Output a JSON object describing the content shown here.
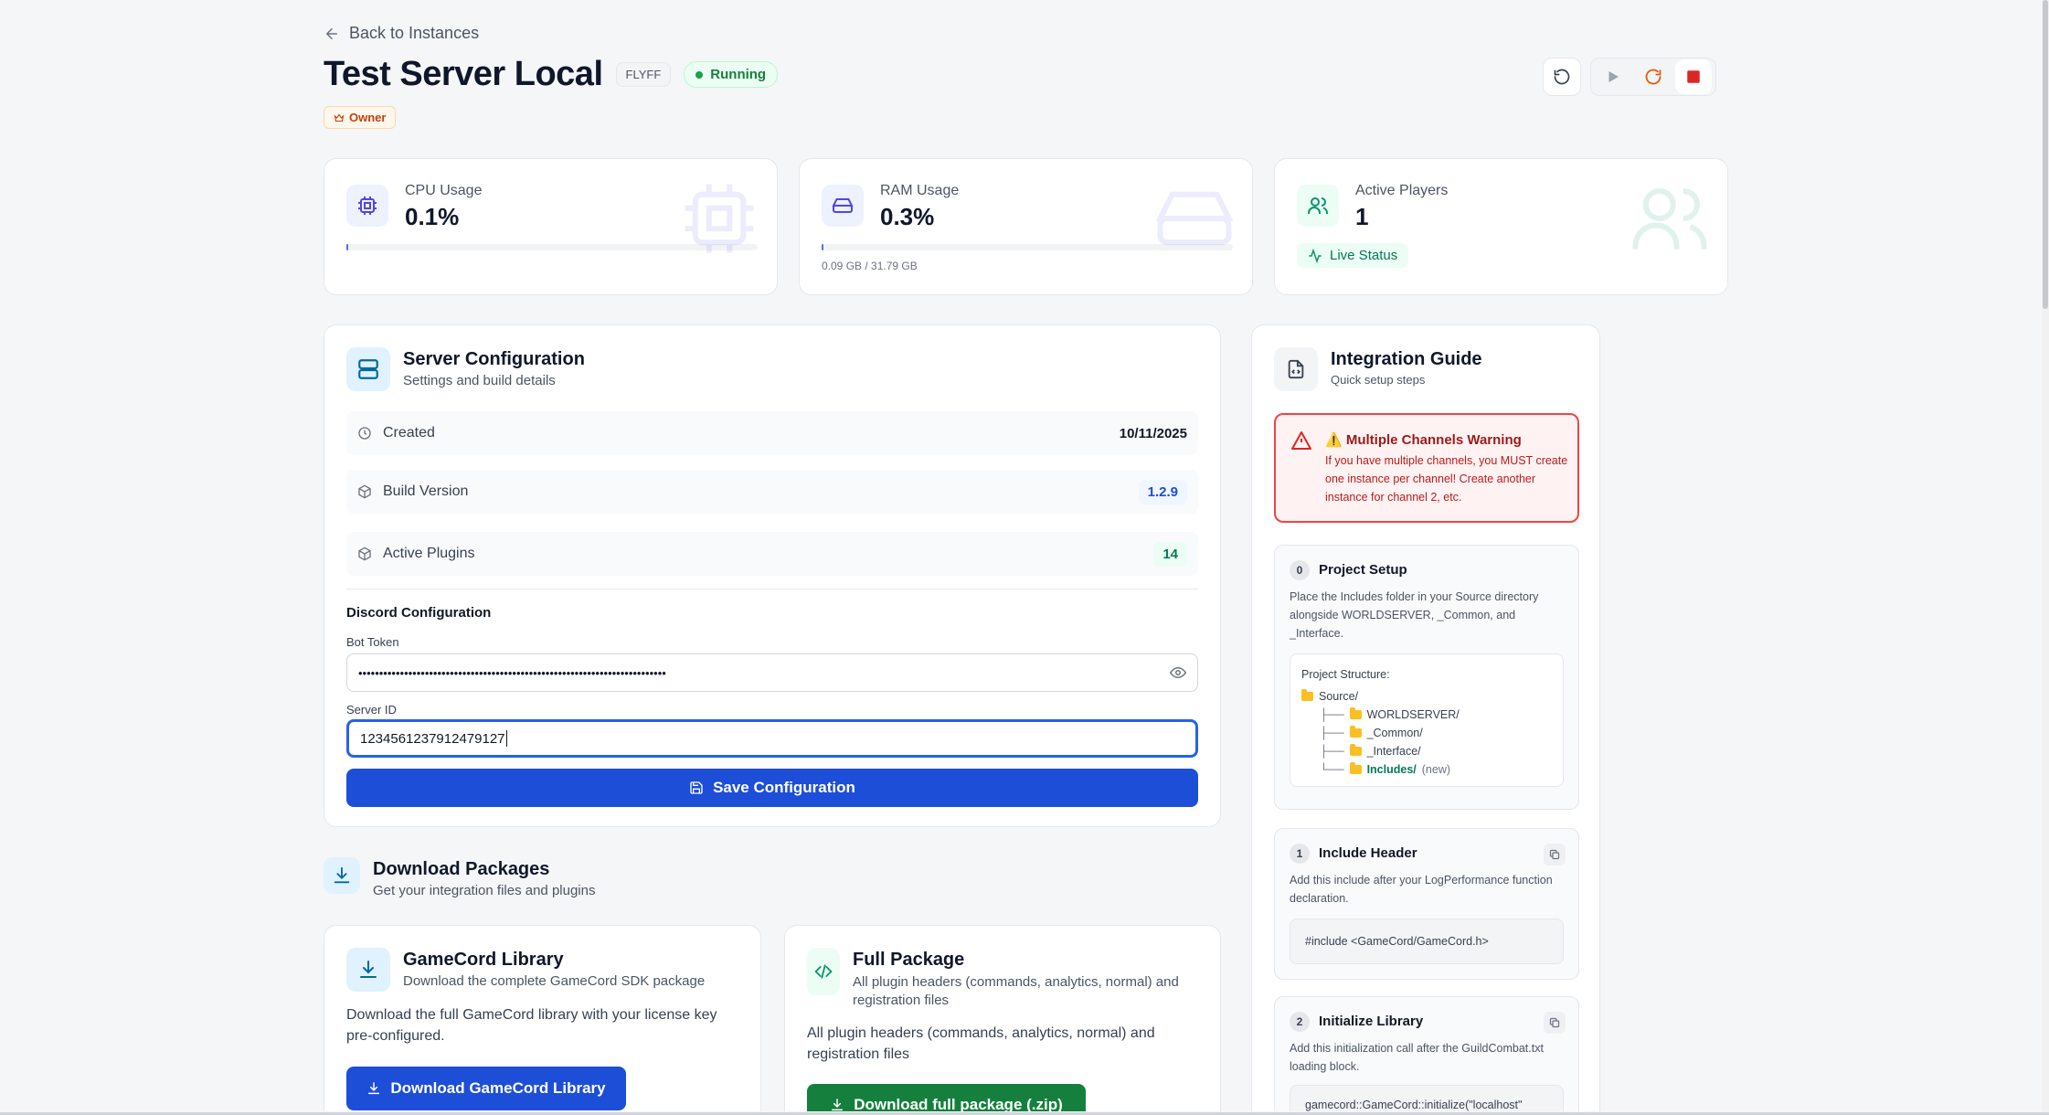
{
  "nav": {
    "back_label": "Back to Instances"
  },
  "instance": {
    "title": "Test Server Local",
    "game_tag": "FLYFF",
    "status": "Running",
    "role": "Owner"
  },
  "stats": {
    "cpu": {
      "label": "CPU Usage",
      "value": "0.1%",
      "fraction": 0.001
    },
    "ram": {
      "label": "RAM Usage",
      "value": "0.3%",
      "fraction": 0.003,
      "detail": "0.09 GB / 31.79 GB"
    },
    "players": {
      "label": "Active Players",
      "value": "1",
      "live_label": "Live Status"
    }
  },
  "server_config": {
    "title": "Server Configuration",
    "subtitle": "Settings and build details",
    "rows": [
      {
        "label": "Created",
        "value": "10/11/2025"
      },
      {
        "label": "Build Version",
        "value": "1.2.9"
      },
      {
        "label": "Active Plugins",
        "value": "14"
      }
    ],
    "discord": {
      "heading": "Discord Configuration",
      "bot_token_label": "Bot Token",
      "bot_token_value": "••••••••••••••••••••••••••••••••••••••••••••••••••••••••••••••••••••••••••",
      "server_id_label": "Server ID",
      "server_id_value": "1234561237912479127"
    },
    "save_label": "Save Configuration"
  },
  "downloads": {
    "title": "Download Packages",
    "subtitle": "Get your integration files and plugins",
    "library": {
      "title": "GameCord Library",
      "subtitle": "Download the complete GameCord SDK package",
      "body": "Download the full GameCord library with your license key pre-configured.",
      "button": "Download GameCord Library"
    },
    "full": {
      "title": "Full Package",
      "subtitle": "All plugin headers (commands, analytics, normal) and registration files",
      "body": "All plugin headers (commands, analytics, normal) and registration files",
      "button": "Download full package (.zip)"
    }
  },
  "guide": {
    "title": "Integration Guide",
    "subtitle": "Quick setup steps",
    "warning": {
      "title": "⚠️ Multiple Channels Warning",
      "body": "If you have multiple channels, you MUST create one instance per channel! Create another instance for channel 2, etc."
    },
    "steps": [
      {
        "num": "0",
        "title": "Project Setup",
        "desc": "Place the Includes folder in your Source directory alongside WORLDSERVER, _Common, and _Interface.",
        "structure_label": "Project Structure:",
        "tree": {
          "root": "Source/",
          "children": [
            "WORLDSERVER/",
            "_Common/",
            "_Interface/",
            "Includes/"
          ],
          "new_tag": "(new)"
        }
      },
      {
        "num": "1",
        "title": "Include Header",
        "desc": "Add this include after your LogPerformance function declaration.",
        "code": "#include <GameCord/GameCord.h>"
      },
      {
        "num": "2",
        "title": "Initialize Library",
        "desc": "Add this initialization call after the GuildCombat.txt loading block.",
        "code": "gamecord::GameCord::initialize(\"localhost\""
      }
    ]
  },
  "colors": {
    "primary": "#1d4ed8",
    "success": "#16a34a",
    "danger": "#dc2626",
    "warning_orange": "#ea580c",
    "cpu_accent": "#6366f1",
    "ram_accent": "#4f46e5",
    "players_accent": "#059669"
  },
  "icons": {
    "back": "arrow-left-icon",
    "restart": "rotate-ccw-icon",
    "play": "play-icon",
    "restart_orange": "rotate-cw-icon",
    "stop": "stop-icon",
    "cpu": "cpu-icon",
    "ram": "hard-drive-icon",
    "players": "users-icon",
    "eye": "eye-icon",
    "save": "save-icon",
    "download": "download-icon",
    "code": "code-icon"
  }
}
